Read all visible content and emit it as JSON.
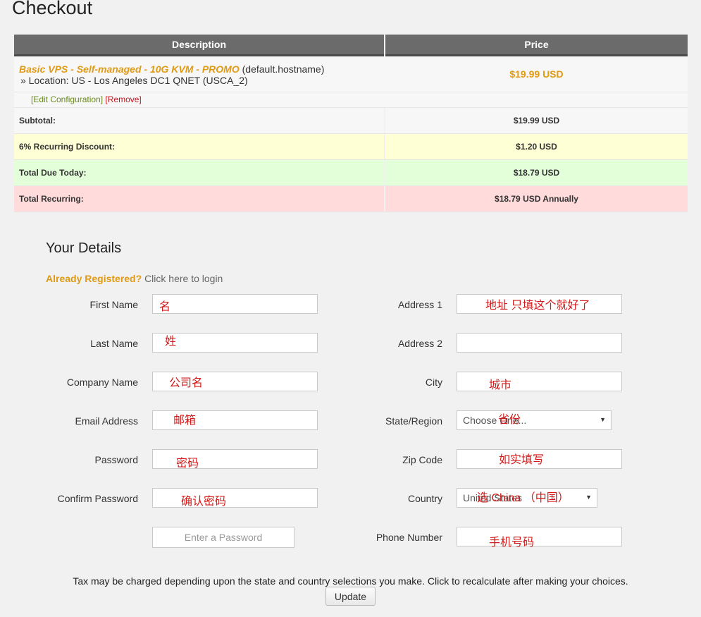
{
  "page": {
    "title": "Checkout"
  },
  "cart": {
    "headers": [
      "Description",
      "Price"
    ],
    "item": {
      "name": "Basic VPS - Self-managed - 10G KVM - PROMO",
      "hostname": " (default.hostname)",
      "location": "» Location: US - Los Angeles DC1 QNET (USCA_2)",
      "price": "$19.99 USD",
      "edit_label": "[Edit Configuration]",
      "remove_label": "[Remove]"
    },
    "summary": [
      {
        "label": "Subtotal:",
        "value": "$19.99 USD"
      },
      {
        "label": "6% Recurring Discount:",
        "value": "$1.20 USD"
      },
      {
        "label": "Total Due Today:",
        "value": "$18.79 USD"
      },
      {
        "label": "Total Recurring:",
        "value": "$18.79 USD Annually"
      }
    ]
  },
  "details": {
    "title": "Your Details",
    "already_registered": "Already Registered?",
    "login_link": "Click here to login",
    "left_fields": [
      {
        "label": "First Name",
        "value": "",
        "note": "名"
      },
      {
        "label": "Last Name",
        "value": "",
        "note": "姓"
      },
      {
        "label": "Company Name",
        "value": "",
        "note": "公司名"
      },
      {
        "label": "Email Address",
        "value": "",
        "note": "邮箱"
      },
      {
        "label": "Password",
        "value": "",
        "note": "密码"
      },
      {
        "label": "Confirm Password",
        "value": "",
        "note": "确认密码"
      }
    ],
    "password_strength_placeholder": "Enter a Password",
    "right_fields": [
      {
        "label": "Address 1",
        "value": "",
        "note": "地址 只填这个就好了"
      },
      {
        "label": "Address 2",
        "value": "",
        "note": ""
      },
      {
        "label": "City",
        "value": "",
        "note": "城市"
      },
      {
        "label": "State/Region",
        "value": "Choose One...",
        "note": "省份"
      },
      {
        "label": "Zip Code",
        "value": "",
        "note": "如实填写"
      },
      {
        "label": "Country",
        "value": "United States",
        "note": "选 China （中国）"
      },
      {
        "label": "Phone Number",
        "value": "",
        "note": "手机号码"
      }
    ]
  },
  "footer": {
    "tax_note": "Tax may be charged depending upon the state and country selections you make. Click to recalculate after making your choices.",
    "update_label": "Update"
  },
  "colors": {
    "accent_orange": "#e09a14",
    "link_green": "#6a8a1c",
    "remove_red": "#c0181f",
    "annotation_red": "#d21a1a",
    "header_gray": "#6b6b6b"
  }
}
